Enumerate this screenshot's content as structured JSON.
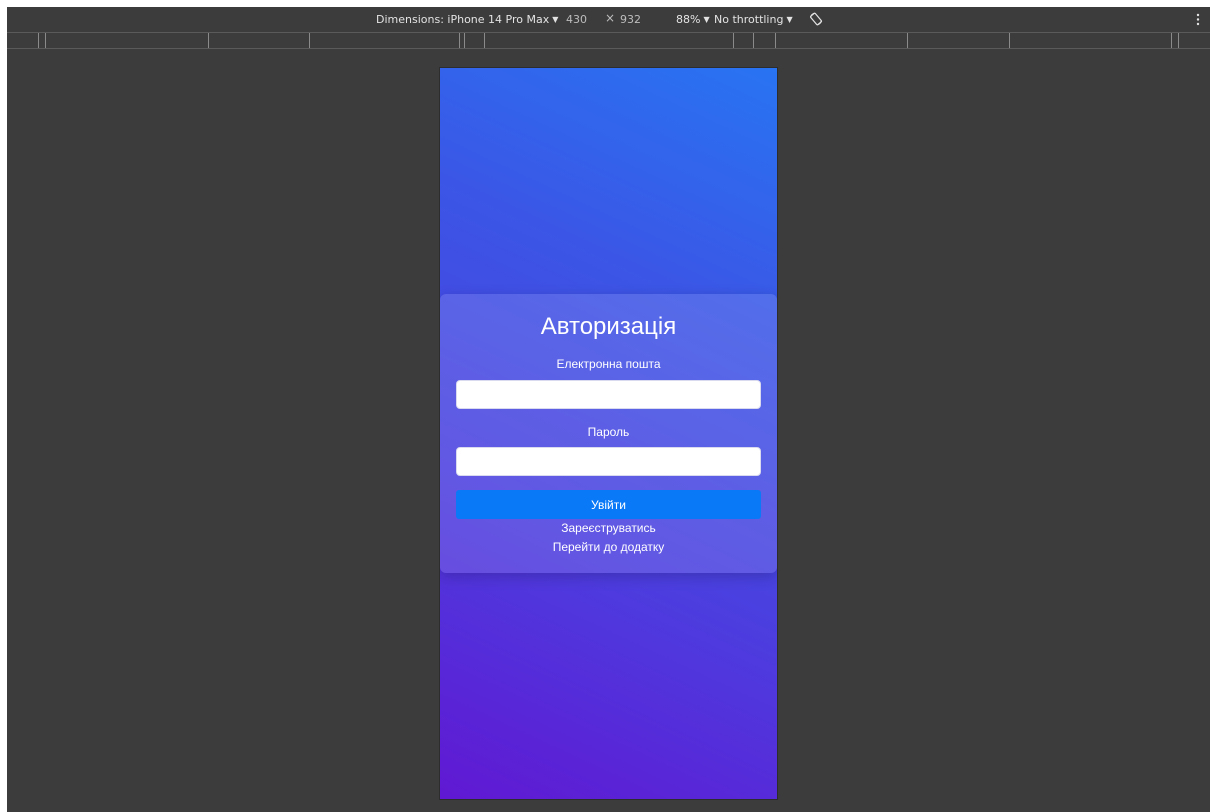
{
  "devtools": {
    "dimensions_label": "Dimensions: iPhone 14 Pro Max",
    "width": "430",
    "times": "×",
    "height": "932",
    "zoom": "88%",
    "throttling": "No throttling",
    "icons": {
      "dropdown": "caret-down-icon",
      "rotate": "rotate-icon",
      "more": "more-vert-icon"
    }
  },
  "page": {
    "title": "Авторизація",
    "email_label": "Електронна пошта",
    "email_value": "",
    "password_label": "Пароль",
    "password_value": "",
    "login_button": "Увійти",
    "register_link": "Зареєструватись",
    "app_link": "Перейти до додатку"
  },
  "colors": {
    "devtools_bg": "#3c3c3c",
    "gradient_top": "#2874f2",
    "gradient_bottom": "#6018d2",
    "button": "#0a79f7"
  }
}
